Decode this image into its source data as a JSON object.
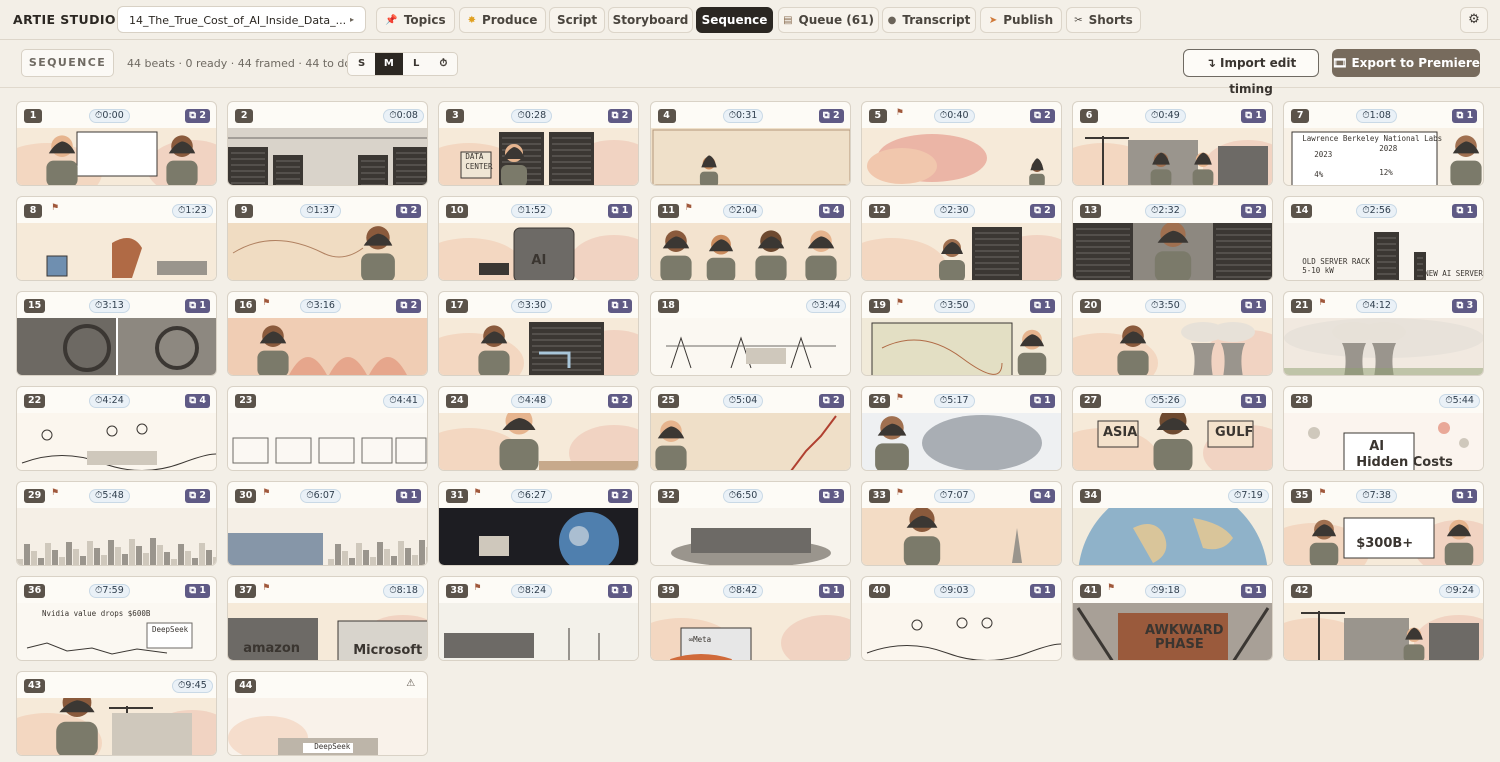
{
  "app": {
    "name": "ARTIE STUDIO",
    "project_title": "14_The_True_Cost_of_AI_Inside_Data_..."
  },
  "nav": {
    "tabs": [
      {
        "label": "Topics",
        "icon": "pin-icon"
      },
      {
        "label": "Produce",
        "icon": "sparkle-icon"
      },
      {
        "label": "Script",
        "icon": ""
      },
      {
        "label": "Storyboard",
        "icon": ""
      },
      {
        "label": "Sequence",
        "icon": "",
        "active": true
      },
      {
        "label": "Queue (61)",
        "icon": "clipboard-icon"
      },
      {
        "label": "Transcript",
        "icon": "mic-icon"
      },
      {
        "label": "Publish",
        "icon": "send-icon"
      },
      {
        "label": "Shorts",
        "icon": "scissors-icon"
      }
    ]
  },
  "toolbar": {
    "section_label": "SEQUENCE",
    "stats": "44 beats · 0 ready · 44 framed · 44 to do",
    "sizes": [
      "S",
      "M",
      "L",
      "⏱"
    ],
    "active_size": "M",
    "import_label": "Import edit timing",
    "export_label": "Export to Premiere"
  },
  "colors": {
    "accent": "#2b2722",
    "export_button": "#776b5d",
    "count_badge": "#5f5a85",
    "time_pill": "#eaf1f7"
  },
  "beats": [
    {
      "num": "1",
      "time": "0:00",
      "count": "2",
      "flag": false,
      "thumb": "lab-duo"
    },
    {
      "num": "2",
      "time": "0:08",
      "count": "",
      "flag": false,
      "thumb": "server-hall"
    },
    {
      "num": "3",
      "time": "0:28",
      "count": "2",
      "flag": false,
      "thumb": "data-center-sign",
      "overlay": [
        "DATA",
        "CENTER"
      ]
    },
    {
      "num": "4",
      "time": "0:31",
      "count": "2",
      "flag": false,
      "thumb": "paper-peek"
    },
    {
      "num": "5",
      "time": "0:40",
      "count": "2",
      "flag": true,
      "thumb": "cloud"
    },
    {
      "num": "6",
      "time": "0:49",
      "count": "1",
      "flag": false,
      "thumb": "construction"
    },
    {
      "num": "7",
      "time": "1:08",
      "count": "1",
      "flag": false,
      "thumb": "berkeley-chart",
      "overlay": [
        "Lawrence Berkeley National Labs",
        "2023",
        "2028",
        "4%",
        "12%"
      ]
    },
    {
      "num": "8",
      "time": "1:23",
      "count": "",
      "flag": true,
      "thumb": "chip-pour"
    },
    {
      "num": "9",
      "time": "1:37",
      "count": "2",
      "flag": false,
      "thumb": "map-man"
    },
    {
      "num": "10",
      "time": "1:52",
      "count": "1",
      "flag": false,
      "thumb": "ai-chip",
      "overlay": [
        "AI"
      ]
    },
    {
      "num": "11",
      "time": "2:04",
      "count": "4",
      "flag": true,
      "thumb": "group"
    },
    {
      "num": "12",
      "time": "2:30",
      "count": "2",
      "flag": false,
      "thumb": "rack-open"
    },
    {
      "num": "13",
      "time": "2:32",
      "count": "2",
      "flag": false,
      "thumb": "woman-servers"
    },
    {
      "num": "14",
      "time": "2:56",
      "count": "1",
      "flag": false,
      "thumb": "rack-compare",
      "overlay": [
        "OLD SERVER RACK",
        "5-10 kW",
        "NEW AI SERVER RACK"
      ]
    },
    {
      "num": "15",
      "time": "3:13",
      "count": "1",
      "flag": false,
      "thumb": "fans"
    },
    {
      "num": "16",
      "time": "3:16",
      "count": "2",
      "flag": true,
      "thumb": "heat"
    },
    {
      "num": "17",
      "time": "3:30",
      "count": "1",
      "flag": false,
      "thumb": "cooling"
    },
    {
      "num": "18",
      "time": "3:44",
      "count": "",
      "flag": false,
      "thumb": "grid-diagram"
    },
    {
      "num": "19",
      "time": "3:50",
      "count": "1",
      "flag": true,
      "thumb": "map-board"
    },
    {
      "num": "20",
      "time": "3:50",
      "count": "1",
      "flag": false,
      "thumb": "towers-man"
    },
    {
      "num": "21",
      "time": "4:12",
      "count": "3",
      "flag": true,
      "thumb": "towers"
    },
    {
      "num": "22",
      "time": "4:24",
      "count": "4",
      "flag": false,
      "thumb": "timeline"
    },
    {
      "num": "23",
      "time": "4:41",
      "count": "",
      "flag": false,
      "thumb": "sketch-row"
    },
    {
      "num": "24",
      "time": "4:48",
      "count": "2",
      "flag": false,
      "thumb": "man-desk"
    },
    {
      "num": "25",
      "time": "5:04",
      "count": "2",
      "flag": false,
      "thumb": "graph-man"
    },
    {
      "num": "26",
      "time": "5:17",
      "count": "1",
      "flag": true,
      "thumb": "woman-map"
    },
    {
      "num": "27",
      "time": "5:26",
      "count": "1",
      "flag": false,
      "thumb": "asia-gulf",
      "overlay": [
        "ASIA",
        "GULF"
      ]
    },
    {
      "num": "28",
      "time": "5:44",
      "count": "",
      "flag": false,
      "thumb": "hidden-costs",
      "overlay": [
        "AI",
        "Hidden Costs"
      ]
    },
    {
      "num": "29",
      "time": "5:48",
      "count": "2",
      "flag": true,
      "thumb": "skyline"
    },
    {
      "num": "30",
      "time": "6:07",
      "count": "1",
      "flag": true,
      "thumb": "rooftops"
    },
    {
      "num": "31",
      "time": "6:27",
      "count": "2",
      "flag": true,
      "thumb": "space"
    },
    {
      "num": "32",
      "time": "6:50",
      "count": "3",
      "flag": false,
      "thumb": "campus"
    },
    {
      "num": "33",
      "time": "7:07",
      "count": "4",
      "flag": true,
      "thumb": "woman-rocket"
    },
    {
      "num": "34",
      "time": "7:19",
      "count": "",
      "flag": false,
      "thumb": "globe"
    },
    {
      "num": "35",
      "time": "7:38",
      "count": "1",
      "flag": true,
      "thumb": "billboard",
      "overlay": [
        "$300B+"
      ]
    },
    {
      "num": "36",
      "time": "7:59",
      "count": "1",
      "flag": false,
      "thumb": "nvidia",
      "overlay": [
        "Nvidia value drops $600B",
        "DeepSeek"
      ]
    },
    {
      "num": "37",
      "time": "8:18",
      "count": "",
      "flag": true,
      "thumb": "amazon",
      "overlay": [
        "amazon",
        "Microsoft"
      ]
    },
    {
      "num": "38",
      "time": "8:24",
      "count": "1",
      "flag": true,
      "thumb": "wind"
    },
    {
      "num": "39",
      "time": "8:42",
      "count": "1",
      "flag": false,
      "thumb": "meta",
      "overlay": [
        "∞Meta"
      ]
    },
    {
      "num": "40",
      "time": "9:03",
      "count": "1",
      "flag": false,
      "thumb": "timeline2"
    },
    {
      "num": "41",
      "time": "9:18",
      "count": "1",
      "flag": true,
      "thumb": "awkward",
      "overlay": [
        "AWKWARD",
        "PHASE"
      ]
    },
    {
      "num": "42",
      "time": "9:24",
      "count": "",
      "flag": false,
      "thumb": "construction2"
    },
    {
      "num": "43",
      "time": "9:45",
      "count": "",
      "flag": false,
      "thumb": "woman-building"
    },
    {
      "num": "44",
      "time": "",
      "count": "",
      "flag": false,
      "warn": true,
      "thumb": "deepseek",
      "overlay": [
        "DeepSeek"
      ]
    }
  ]
}
